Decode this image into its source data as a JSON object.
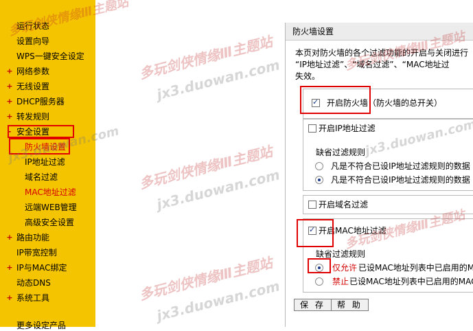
{
  "sidebar": {
    "items": [
      {
        "label": "运行状态",
        "marker": ""
      },
      {
        "label": "设置向导",
        "marker": ""
      },
      {
        "label": "WPS一键安全设定",
        "marker": ""
      },
      {
        "label": "网络参数",
        "marker": "+"
      },
      {
        "label": "无线设置",
        "marker": "+"
      },
      {
        "label": "DHCP服务器",
        "marker": "+"
      },
      {
        "label": "转发规则",
        "marker": "+"
      },
      {
        "label": "安全设置",
        "marker": "-"
      },
      {
        "label": "防火墙设置",
        "marker": ""
      },
      {
        "label": "IP地址过滤",
        "marker": ""
      },
      {
        "label": "域名过滤",
        "marker": ""
      },
      {
        "label": "MAC地址过滤",
        "marker": ""
      },
      {
        "label": "远端WEB管理",
        "marker": ""
      },
      {
        "label": "高级安全设置",
        "marker": ""
      },
      {
        "label": "路由功能",
        "marker": "+"
      },
      {
        "label": "IP带宽控制",
        "marker": ""
      },
      {
        "label": "IP与MAC绑定",
        "marker": "+"
      },
      {
        "label": "动态DNS",
        "marker": ""
      },
      {
        "label": "系统工具",
        "marker": "+"
      },
      {
        "label": "更多设定产品",
        "marker": ""
      }
    ]
  },
  "panel": {
    "title": "防火墙设置",
    "desc_line1": "本页对防火墙的各个过滤功能的开启与关闭进行",
    "desc_line2": "“IP地址过滤”、“域名过滤”、“MAC地址过",
    "desc_line3": "失效。",
    "firewall_label": "开启防火墙（防火墙的总开关）",
    "ip_filter_label": "开启IP地址过滤",
    "ip_default_rule": "缺省过滤规则",
    "ip_rule_1": "凡是不符合已设IP地址过滤规则的数据",
    "ip_rule_2": "凡是不符合已设IP地址过滤规则的数据",
    "domain_filter_label": "开启域名过滤",
    "mac_filter_label": "开启MAC地址过滤",
    "mac_default_rule": "缺省过滤规则",
    "mac_rule_1_prefix": "仅允许",
    "mac_rule_1_suffix": "已设MAC地址列表中已启用的MAC",
    "mac_rule_2_prefix": "禁止",
    "mac_rule_2_suffix": "已设MAC地址列表中已启用的MAC地",
    "save_label": "保 存",
    "help_label": "帮 助"
  },
  "states": {
    "firewall_enabled": true,
    "ip_filter_enabled": false,
    "ip_rule_selected": 2,
    "domain_filter_enabled": false,
    "mac_filter_enabled": true,
    "mac_rule_selected": 1
  },
  "watermarks": {
    "cn": "多玩剑侠情缘Ⅲ主题站",
    "url": "jx3.duowan.com"
  },
  "colors": {
    "sidebar_bg": "#f5c400",
    "highlight": "#e00000",
    "active_link": "#d40000",
    "panel_header": "#ececec"
  }
}
